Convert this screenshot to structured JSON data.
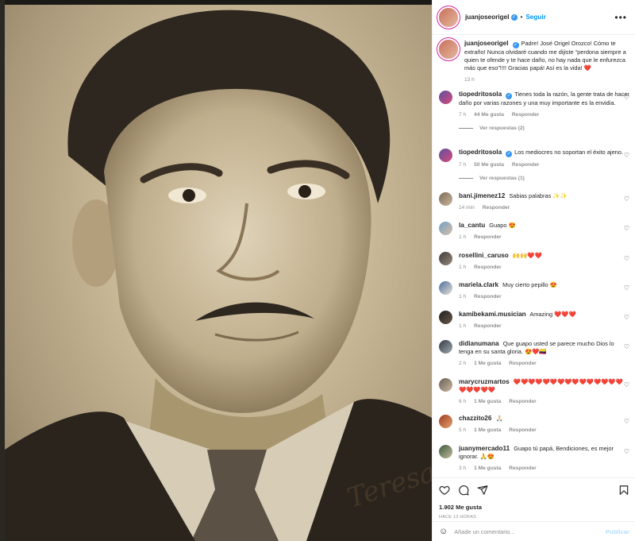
{
  "post": {
    "author": "juanjoseorigel",
    "follow_label": "Seguir",
    "separator": "•",
    "more": "•••",
    "signature": "Teresa",
    "caption": "Padre! José Origel Orozco! Cómo te extraño! Nunca olvidaré cuando me dijiste “perdona siempre a quien te ofende y te hace daño, no hay nada que le enfurezca más que eso”!!!! Gracias papá! Así es la vida! ❤️",
    "caption_time": "13 h"
  },
  "comments": [
    {
      "user": "tiopedritosola",
      "verified": true,
      "text": "Tienes toda la razón, la gente trata de hacer daño por varias razones y una muy importante es la envidia.",
      "time": "7 h",
      "likes": "44 Me gusta",
      "reply": "Responder",
      "replies": "Ver respuestas (2)"
    },
    {
      "user": "tiopedritosola",
      "verified": true,
      "text": "Los mediocres no soportan el éxito ajeno.",
      "time": "7 h",
      "likes": "50 Me gusta",
      "reply": "Responder",
      "replies": "Ver respuestas (1)"
    },
    {
      "user": "bani.jimenez12",
      "text": "Sabias palabras ✨✨",
      "time": "14 min",
      "reply": "Responder"
    },
    {
      "user": "la_cantu",
      "text": "Guapo 😍",
      "time": "1 h",
      "reply": "Responder"
    },
    {
      "user": "rosellini_caruso",
      "text": "🙌🙌❤️❤️",
      "time": "1 h",
      "reply": "Responder"
    },
    {
      "user": "mariela.clark",
      "text": "Muy cierto pepillo 😍",
      "time": "1 h",
      "reply": "Responder"
    },
    {
      "user": "kamibekami.musician",
      "text": "Amazing ❤️❤️❤️",
      "time": "1 h",
      "reply": "Responder"
    },
    {
      "user": "didianumana",
      "text": "Que guapo usted se parece mucho Dios lo tenga en su santa gloria. 😍❤️🇨🇴",
      "time": "2 h",
      "likes": "1 Me gusta",
      "reply": "Responder"
    },
    {
      "user": "marycruzmartos",
      "text": "❤️❤️❤️❤️❤️❤️❤️❤️❤️❤️❤️❤️❤️❤️❤️❤️❤️❤️❤️❤️",
      "time": "6 h",
      "likes": "1 Me gusta",
      "reply": "Responder"
    },
    {
      "user": "chazzito26",
      "text": "🙏🏻",
      "time": "5 h",
      "likes": "1 Me gusta",
      "reply": "Responder"
    },
    {
      "user": "juanymercado11",
      "text": "Guapo tú papá, Bendiciones, es mejor ignorar. 🙏😍",
      "time": "3 h",
      "likes": "1 Me gusta",
      "reply": "Responder"
    }
  ],
  "footer": {
    "likes": "1.902 Me gusta",
    "time_ago": "HACE 13 HORAS",
    "comment_placeholder": "Añade un comentario...",
    "publish_label": "Publicar"
  },
  "icons": {
    "heart": "heart-icon",
    "comment": "comment-icon",
    "share": "share-icon",
    "bookmark": "bookmark-icon",
    "smile": "smile-icon",
    "more": "more-options-icon",
    "verified": "verified-badge-icon"
  },
  "colors": {
    "accent": "#0095f6",
    "muted": "#8e8e8e",
    "verified": "#3897f0",
    "publish_disabled": "#b2dffc"
  }
}
